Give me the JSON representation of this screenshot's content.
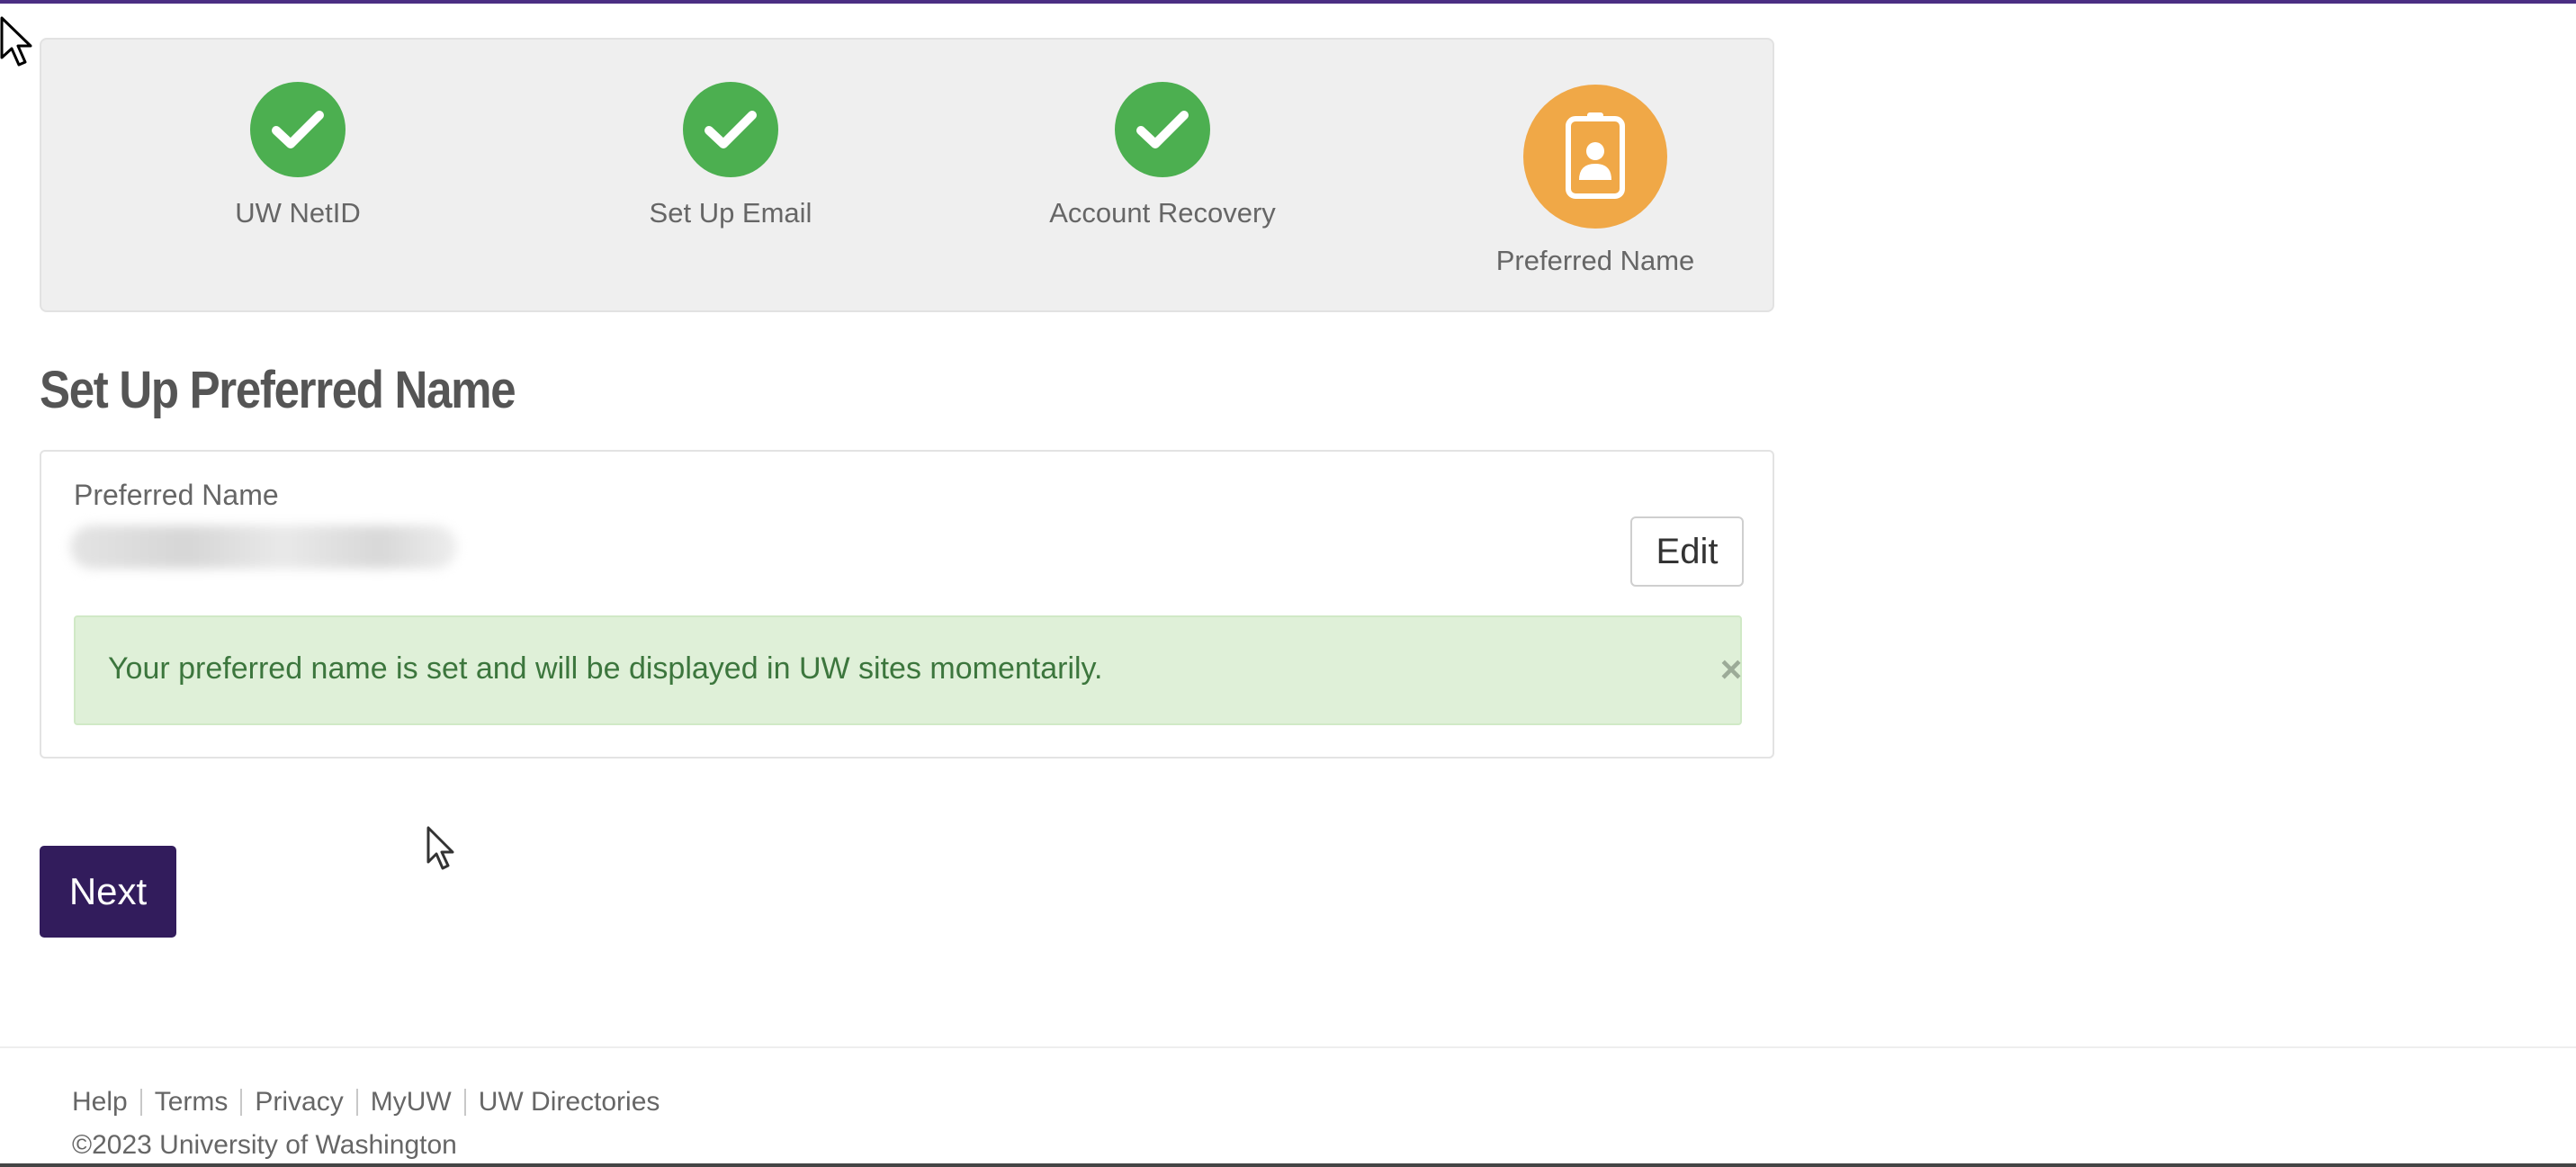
{
  "stepper": {
    "steps": [
      {
        "label": "UW NetID",
        "status": "done",
        "icon": "check-icon"
      },
      {
        "label": "Set Up Email",
        "status": "done",
        "icon": "check-icon"
      },
      {
        "label": "Account Recovery",
        "status": "done",
        "icon": "check-icon"
      },
      {
        "label": "Preferred Name",
        "status": "current",
        "icon": "id-badge-icon"
      }
    ]
  },
  "page": {
    "title": "Set Up Preferred Name"
  },
  "preferred_name": {
    "label": "Preferred Name",
    "edit_label": "Edit",
    "alert_text": "Your preferred name is set and will be displayed in UW sites momentarily.",
    "close_symbol": "×"
  },
  "actions": {
    "next_label": "Next"
  },
  "footer": {
    "links": [
      "Help",
      "Terms",
      "Privacy",
      "MyUW",
      "UW Directories"
    ],
    "copyright": "©2023 University of Washington"
  },
  "colors": {
    "brand_purple": "#4b2e83",
    "button_purple": "#321c5c",
    "done_green": "#4caf50",
    "current_orange": "#f0a847",
    "success_bg": "#dff0d8",
    "success_text": "#3c763d"
  }
}
